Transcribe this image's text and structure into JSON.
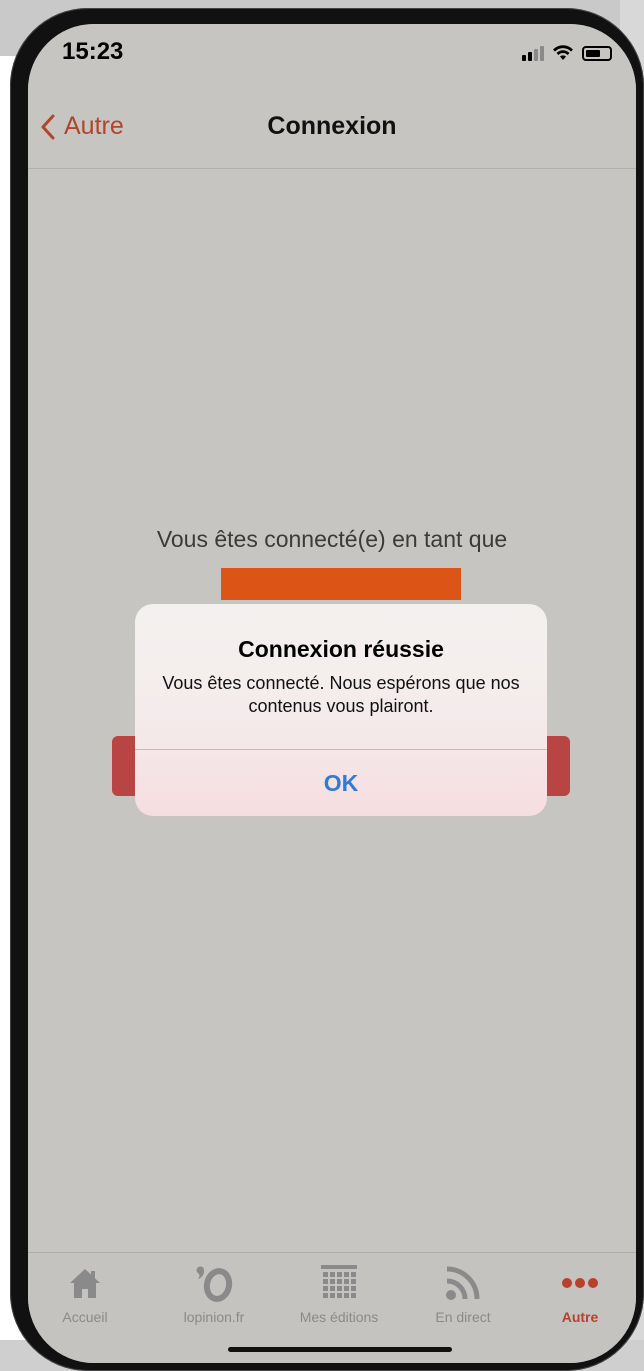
{
  "status_bar": {
    "time": "15:23",
    "signal_icon": "signal-icon",
    "wifi_icon": "wifi-icon",
    "battery_icon": "battery-icon"
  },
  "nav": {
    "back_label": "Autre",
    "title": "Connexion"
  },
  "content": {
    "connected_text": "Vous êtes connecté(e) en tant que",
    "username_redacted_color": "#dd5417"
  },
  "alert": {
    "title": "Connexion réussie",
    "message": "Vous êtes connecté. Nous espérons que nos contenus vous plairont.",
    "ok_label": "OK"
  },
  "tabs": [
    {
      "label": "Accueil",
      "icon": "home-icon"
    },
    {
      "label": "lopinion.fr",
      "icon": "lopinion-logo-icon"
    },
    {
      "label": "Mes éditions",
      "icon": "editions-grid-icon"
    },
    {
      "label": "En direct",
      "icon": "rss-icon"
    },
    {
      "label": "Autre",
      "icon": "more-dots-icon",
      "active": true
    }
  ],
  "colors": {
    "accent": "#b6412c",
    "link_blue": "#2f7bd6",
    "screen_bg": "#c7c5c2"
  }
}
